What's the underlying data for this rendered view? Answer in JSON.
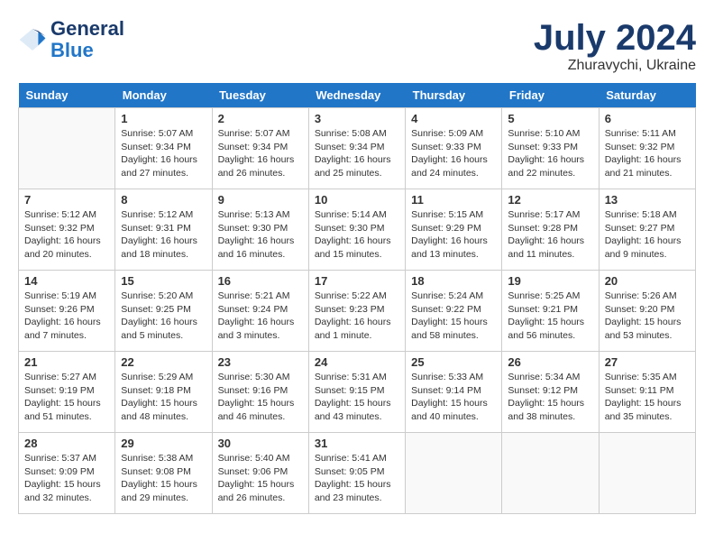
{
  "header": {
    "logo_line1": "General",
    "logo_line2": "Blue",
    "month": "July 2024",
    "location": "Zhuravychi, Ukraine"
  },
  "weekdays": [
    "Sunday",
    "Monday",
    "Tuesday",
    "Wednesday",
    "Thursday",
    "Friday",
    "Saturday"
  ],
  "weeks": [
    [
      {
        "day": "",
        "info": ""
      },
      {
        "day": "1",
        "info": "Sunrise: 5:07 AM\nSunset: 9:34 PM\nDaylight: 16 hours\nand 27 minutes."
      },
      {
        "day": "2",
        "info": "Sunrise: 5:07 AM\nSunset: 9:34 PM\nDaylight: 16 hours\nand 26 minutes."
      },
      {
        "day": "3",
        "info": "Sunrise: 5:08 AM\nSunset: 9:34 PM\nDaylight: 16 hours\nand 25 minutes."
      },
      {
        "day": "4",
        "info": "Sunrise: 5:09 AM\nSunset: 9:33 PM\nDaylight: 16 hours\nand 24 minutes."
      },
      {
        "day": "5",
        "info": "Sunrise: 5:10 AM\nSunset: 9:33 PM\nDaylight: 16 hours\nand 22 minutes."
      },
      {
        "day": "6",
        "info": "Sunrise: 5:11 AM\nSunset: 9:32 PM\nDaylight: 16 hours\nand 21 minutes."
      }
    ],
    [
      {
        "day": "7",
        "info": "Sunrise: 5:12 AM\nSunset: 9:32 PM\nDaylight: 16 hours\nand 20 minutes."
      },
      {
        "day": "8",
        "info": "Sunrise: 5:12 AM\nSunset: 9:31 PM\nDaylight: 16 hours\nand 18 minutes."
      },
      {
        "day": "9",
        "info": "Sunrise: 5:13 AM\nSunset: 9:30 PM\nDaylight: 16 hours\nand 16 minutes."
      },
      {
        "day": "10",
        "info": "Sunrise: 5:14 AM\nSunset: 9:30 PM\nDaylight: 16 hours\nand 15 minutes."
      },
      {
        "day": "11",
        "info": "Sunrise: 5:15 AM\nSunset: 9:29 PM\nDaylight: 16 hours\nand 13 minutes."
      },
      {
        "day": "12",
        "info": "Sunrise: 5:17 AM\nSunset: 9:28 PM\nDaylight: 16 hours\nand 11 minutes."
      },
      {
        "day": "13",
        "info": "Sunrise: 5:18 AM\nSunset: 9:27 PM\nDaylight: 16 hours\nand 9 minutes."
      }
    ],
    [
      {
        "day": "14",
        "info": "Sunrise: 5:19 AM\nSunset: 9:26 PM\nDaylight: 16 hours\nand 7 minutes."
      },
      {
        "day": "15",
        "info": "Sunrise: 5:20 AM\nSunset: 9:25 PM\nDaylight: 16 hours\nand 5 minutes."
      },
      {
        "day": "16",
        "info": "Sunrise: 5:21 AM\nSunset: 9:24 PM\nDaylight: 16 hours\nand 3 minutes."
      },
      {
        "day": "17",
        "info": "Sunrise: 5:22 AM\nSunset: 9:23 PM\nDaylight: 16 hours\nand 1 minute."
      },
      {
        "day": "18",
        "info": "Sunrise: 5:24 AM\nSunset: 9:22 PM\nDaylight: 15 hours\nand 58 minutes."
      },
      {
        "day": "19",
        "info": "Sunrise: 5:25 AM\nSunset: 9:21 PM\nDaylight: 15 hours\nand 56 minutes."
      },
      {
        "day": "20",
        "info": "Sunrise: 5:26 AM\nSunset: 9:20 PM\nDaylight: 15 hours\nand 53 minutes."
      }
    ],
    [
      {
        "day": "21",
        "info": "Sunrise: 5:27 AM\nSunset: 9:19 PM\nDaylight: 15 hours\nand 51 minutes."
      },
      {
        "day": "22",
        "info": "Sunrise: 5:29 AM\nSunset: 9:18 PM\nDaylight: 15 hours\nand 48 minutes."
      },
      {
        "day": "23",
        "info": "Sunrise: 5:30 AM\nSunset: 9:16 PM\nDaylight: 15 hours\nand 46 minutes."
      },
      {
        "day": "24",
        "info": "Sunrise: 5:31 AM\nSunset: 9:15 PM\nDaylight: 15 hours\nand 43 minutes."
      },
      {
        "day": "25",
        "info": "Sunrise: 5:33 AM\nSunset: 9:14 PM\nDaylight: 15 hours\nand 40 minutes."
      },
      {
        "day": "26",
        "info": "Sunrise: 5:34 AM\nSunset: 9:12 PM\nDaylight: 15 hours\nand 38 minutes."
      },
      {
        "day": "27",
        "info": "Sunrise: 5:35 AM\nSunset: 9:11 PM\nDaylight: 15 hours\nand 35 minutes."
      }
    ],
    [
      {
        "day": "28",
        "info": "Sunrise: 5:37 AM\nSunset: 9:09 PM\nDaylight: 15 hours\nand 32 minutes."
      },
      {
        "day": "29",
        "info": "Sunrise: 5:38 AM\nSunset: 9:08 PM\nDaylight: 15 hours\nand 29 minutes."
      },
      {
        "day": "30",
        "info": "Sunrise: 5:40 AM\nSunset: 9:06 PM\nDaylight: 15 hours\nand 26 minutes."
      },
      {
        "day": "31",
        "info": "Sunrise: 5:41 AM\nSunset: 9:05 PM\nDaylight: 15 hours\nand 23 minutes."
      },
      {
        "day": "",
        "info": ""
      },
      {
        "day": "",
        "info": ""
      },
      {
        "day": "",
        "info": ""
      }
    ]
  ]
}
